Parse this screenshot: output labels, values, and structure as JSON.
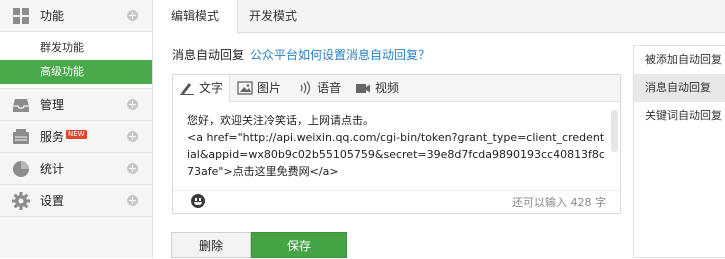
{
  "sidebar": {
    "groups": [
      {
        "label": "功能",
        "icon": "grid-icon"
      },
      {
        "label": "管理",
        "icon": "inbox-icon"
      },
      {
        "label": "服务",
        "icon": "server-icon",
        "badge": "NEW"
      },
      {
        "label": "统计",
        "icon": "pie-chart-icon"
      },
      {
        "label": "设置",
        "icon": "gear-icon"
      }
    ],
    "subitems": [
      {
        "label": "群发功能"
      },
      {
        "label": "高级功能"
      }
    ]
  },
  "tabs": [
    {
      "label": "编辑模式"
    },
    {
      "label": "开发模式"
    }
  ],
  "main": {
    "title": "消息自动回复",
    "help_link": "公众平台如何设置消息自动回复？"
  },
  "editor": {
    "tools": [
      {
        "label": "文字",
        "icon": "pencil-icon"
      },
      {
        "label": "图片",
        "icon": "image-icon"
      },
      {
        "label": "语音",
        "icon": "sound-icon"
      },
      {
        "label": "视频",
        "icon": "video-icon"
      }
    ],
    "line1": "您好，欢迎关注冷笑话，上网请点击。",
    "line2": "<a href=\"http://api.weixin.qq.com/cgi-bin/token?grant_type=client_credential&appid=wx80b9c02b55105759&secret=39e8d7fcda9890193cc40813f8c73afe\">点击这里免费网</a>",
    "remaining": "还可以输入 428 字"
  },
  "buttons": {
    "delete": "删除",
    "save": "保存"
  },
  "rightpanel": {
    "items": [
      {
        "label": "被添加自动回复"
      },
      {
        "label": "消息自动回复"
      },
      {
        "label": "关键词自动回复"
      }
    ]
  },
  "colors": {
    "accent": "#49a84a",
    "link": "#2a80c4",
    "badge": "#e2462a"
  }
}
